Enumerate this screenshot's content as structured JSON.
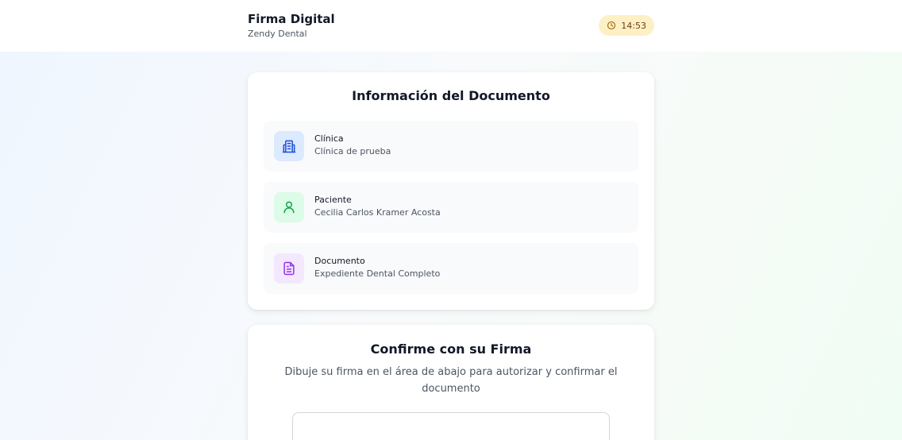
{
  "header": {
    "title": "Firma Digital",
    "subtitle": "Zendy Dental",
    "time": "14:53",
    "time_icon": "clock-icon"
  },
  "document_info": {
    "title": "Información del Documento",
    "items": [
      {
        "label": "Clínica",
        "value": "Clínica de prueba",
        "icon": "building-icon",
        "color": "#1d4ed8"
      },
      {
        "label": "Paciente",
        "value": "Cecilia Carlos Kramer Acosta",
        "icon": "user-icon",
        "color": "#16a34a"
      },
      {
        "label": "Documento",
        "value": "Expediente Dental Completo",
        "icon": "document-icon",
        "color": "#9333ea"
      }
    ]
  },
  "signature": {
    "title": "Confirme con su Firma",
    "description": "Dibuje su firma en el área de abajo para autorizar y confirmar el documento"
  },
  "colors": {
    "badge_bg": "#fdf0c4",
    "badge_text": "#713f12",
    "row_bg": "#f9fafb"
  }
}
